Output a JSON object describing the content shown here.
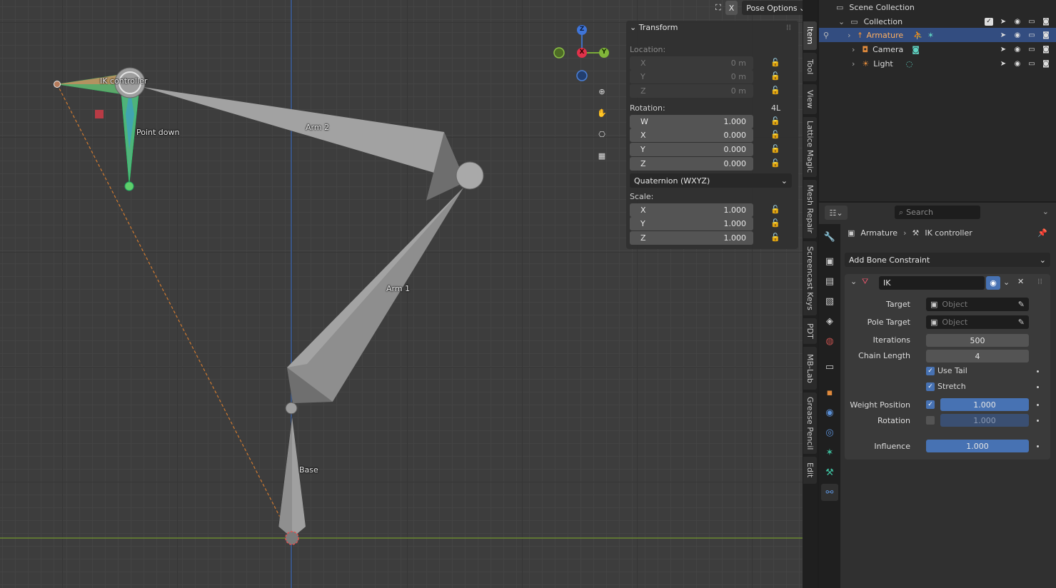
{
  "viewport": {
    "header": {
      "x_label": "X",
      "pose_options_label": "Pose Options"
    },
    "gizmo": {
      "z": "Z",
      "x": "X",
      "y": "Y"
    },
    "bones": [
      {
        "name": "IK controller"
      },
      {
        "name": "Point down"
      },
      {
        "name": "Arm 2"
      },
      {
        "name": "Arm 1"
      },
      {
        "name": "Base"
      }
    ]
  },
  "n_panel": {
    "title": "Transform",
    "location_label": "Location:",
    "location": [
      {
        "axis": "X",
        "value": "0 m"
      },
      {
        "axis": "Y",
        "value": "0 m"
      },
      {
        "axis": "Z",
        "value": "0 m"
      }
    ],
    "rotation_label": "Rotation:",
    "rotation_mode_tag": "4L",
    "rotation": [
      {
        "axis": "W",
        "value": "1.000"
      },
      {
        "axis": "X",
        "value": "0.000"
      },
      {
        "axis": "Y",
        "value": "0.000"
      },
      {
        "axis": "Z",
        "value": "0.000"
      }
    ],
    "rotation_mode": "Quaternion (WXYZ)",
    "scale_label": "Scale:",
    "scale": [
      {
        "axis": "X",
        "value": "1.000"
      },
      {
        "axis": "Y",
        "value": "1.000"
      },
      {
        "axis": "Z",
        "value": "1.000"
      }
    ],
    "tabs": [
      "Item",
      "Tool",
      "View",
      "Lattice Magic",
      "Mesh Repair",
      "Screencast Keys",
      "PDT",
      "MB-Lab",
      "Grease Pencil",
      "Edit"
    ]
  },
  "outliner": {
    "scene_collection": "Scene Collection",
    "collection": "Collection",
    "items": [
      {
        "name": "Armature",
        "selected": true
      },
      {
        "name": "Camera",
        "selected": false
      },
      {
        "name": "Light",
        "selected": false
      }
    ]
  },
  "properties": {
    "search_placeholder": "Search",
    "breadcrumb": {
      "object": "Armature",
      "bone": "IK controller"
    },
    "add_constraint_label": "Add Bone Constraint",
    "constraint": {
      "name": "IK",
      "target_label": "Target",
      "target_placeholder": "Object",
      "pole_target_label": "Pole Target",
      "pole_target_placeholder": "Object",
      "iterations_label": "Iterations",
      "iterations": "500",
      "chain_length_label": "Chain Length",
      "chain_length": "4",
      "use_tail_label": "Use Tail",
      "use_tail": true,
      "stretch_label": "Stretch",
      "stretch": true,
      "weight_position_label": "Weight Position",
      "weight_position": "1.000",
      "weight_position_enabled": true,
      "rotation_label": "Rotation",
      "rotation": "1.000",
      "rotation_enabled": false,
      "influence_label": "Influence",
      "influence": "1.000"
    }
  }
}
